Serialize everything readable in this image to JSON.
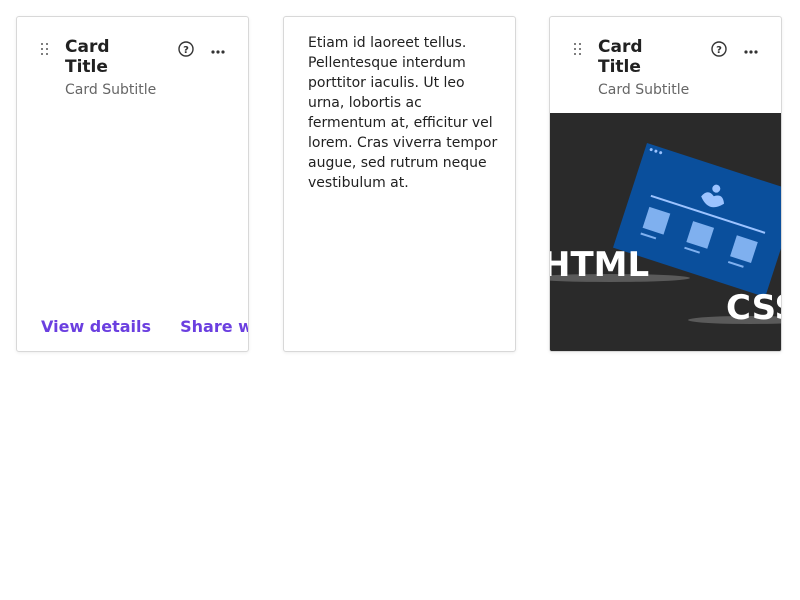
{
  "cards": [
    {
      "title": "Card Title",
      "subtitle": "Card Subtitle",
      "actions": [
        "View details",
        "Share with"
      ]
    },
    {
      "body": "Etiam id laoreet tellus. Pellentesque interdum porttitor iaculis. Ut leo urna, lobortis ac fermentum at, efficitur vel lorem. Cras viverra tempor augue, sed rutrum neque vestibulum at."
    },
    {
      "title": "Card Title",
      "subtitle": "Card Subtitle",
      "media": {
        "word_1": "HTML",
        "word_2": "CSS"
      }
    }
  ],
  "colors": {
    "link": "#6b3fe0",
    "media_bg": "#2a2a2a",
    "media_accent": "#0a4f9c"
  },
  "icons": {
    "drag": "drag-handle-icon",
    "help": "help-circle-icon",
    "more": "more-horizontal-icon"
  }
}
